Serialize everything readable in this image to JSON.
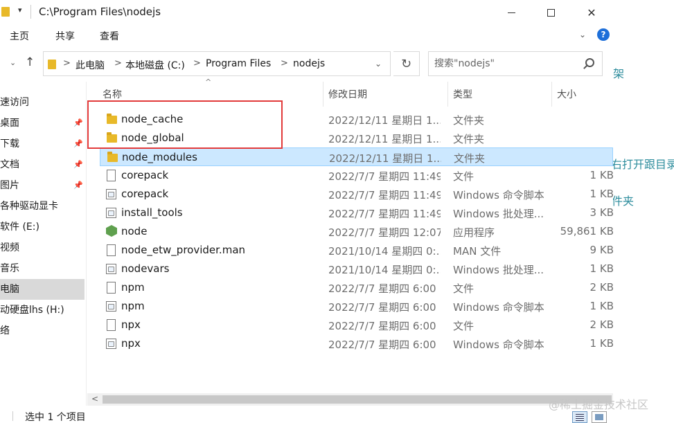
{
  "window": {
    "title": "C:\\Program Files\\nodejs",
    "dropdown_glyph": "▾",
    "close_glyph": "✕"
  },
  "ribbon": {
    "tabs": [
      "主页",
      "共享",
      "查看"
    ],
    "expand_glyph": "⌄",
    "help_glyph": "?"
  },
  "address": {
    "crumbs": [
      "此电脑",
      "本地磁盘 (C:)",
      "Program Files",
      "nodejs"
    ],
    "separator": ">",
    "dropdown_glyph": "⌄",
    "refresh_glyph": "↻",
    "back_glyph": "⌄",
    "up_glyph": "↑"
  },
  "search": {
    "placeholder": "搜索\"nodejs\""
  },
  "nav": {
    "items": [
      {
        "label": "速访问",
        "pinned": false
      },
      {
        "label": "桌面",
        "pinned": true
      },
      {
        "label": "下载",
        "pinned": true
      },
      {
        "label": "文档",
        "pinned": true
      },
      {
        "label": "图片",
        "pinned": true
      },
      {
        "label": "各种驱动显卡",
        "pinned": false
      },
      {
        "label": "软件 (E:)",
        "pinned": false
      },
      {
        "label": "视频",
        "pinned": false
      },
      {
        "label": "音乐",
        "pinned": false
      },
      {
        "label": "电脑",
        "pinned": false,
        "selected": true
      },
      {
        "label": "动硬盘lhs (H:)",
        "pinned": false
      },
      {
        "label": "络",
        "pinned": false
      }
    ],
    "pin_glyph": "📌"
  },
  "columns": {
    "name": "名称",
    "date": "修改日期",
    "type": "类型",
    "size": "大小",
    "sort_glyph": "^"
  },
  "files": [
    {
      "name": "node_cache",
      "date": "2022/12/11 星期日 1...",
      "type": "文件夹",
      "size": "",
      "icon": "folder-icon"
    },
    {
      "name": "node_global",
      "date": "2022/12/11 星期日 1...",
      "type": "文件夹",
      "size": "",
      "icon": "folder-icon"
    },
    {
      "name": "node_modules",
      "date": "2022/12/11 星期日 1...",
      "type": "文件夹",
      "size": "",
      "icon": "folder-icon",
      "selected": true
    },
    {
      "name": "corepack",
      "date": "2022/7/7 星期四 11:49",
      "type": "文件",
      "size": "1 KB",
      "icon": "file-icon"
    },
    {
      "name": "corepack",
      "date": "2022/7/7 星期四 11:49",
      "type": "Windows 命令脚本",
      "size": "1 KB",
      "icon": "script-icon"
    },
    {
      "name": "install_tools",
      "date": "2022/7/7 星期四 11:49",
      "type": "Windows 批处理...",
      "size": "3 KB",
      "icon": "script-icon"
    },
    {
      "name": "node",
      "date": "2022/7/7 星期四 12:07",
      "type": "应用程序",
      "size": "59,861 KB",
      "icon": "node-icon"
    },
    {
      "name": "node_etw_provider.man",
      "date": "2021/10/14 星期四 0:...",
      "type": "MAN 文件",
      "size": "9 KB",
      "icon": "file-icon"
    },
    {
      "name": "nodevars",
      "date": "2021/10/14 星期四 0:...",
      "type": "Windows 批处理...",
      "size": "1 KB",
      "icon": "script-icon"
    },
    {
      "name": "npm",
      "date": "2022/7/7 星期四 6:00",
      "type": "文件",
      "size": "2 KB",
      "icon": "file-icon"
    },
    {
      "name": "npm",
      "date": "2022/7/7 星期四 6:00",
      "type": "Windows 命令脚本",
      "size": "1 KB",
      "icon": "script-icon"
    },
    {
      "name": "npx",
      "date": "2022/7/7 星期四 6:00",
      "type": "文件",
      "size": "2 KB",
      "icon": "file-icon"
    },
    {
      "name": "npx",
      "date": "2022/7/7 星期四 6:00",
      "type": "Windows 命令脚本",
      "size": "1 KB",
      "icon": "script-icon"
    }
  ],
  "scrollbar": {
    "left_glyph": "<"
  },
  "status": {
    "text": "选中 1 个项目"
  },
  "background": {
    "texts": [
      "架",
      "右打开跟目录",
      "件夹"
    ],
    "watermark": "@稀土掘金技术社区",
    "link_color": "#2c8c9c"
  },
  "colors": {
    "highlight_border": "#e23a3a",
    "selection_bg": "#cce8ff",
    "folder": "#e8b929"
  }
}
